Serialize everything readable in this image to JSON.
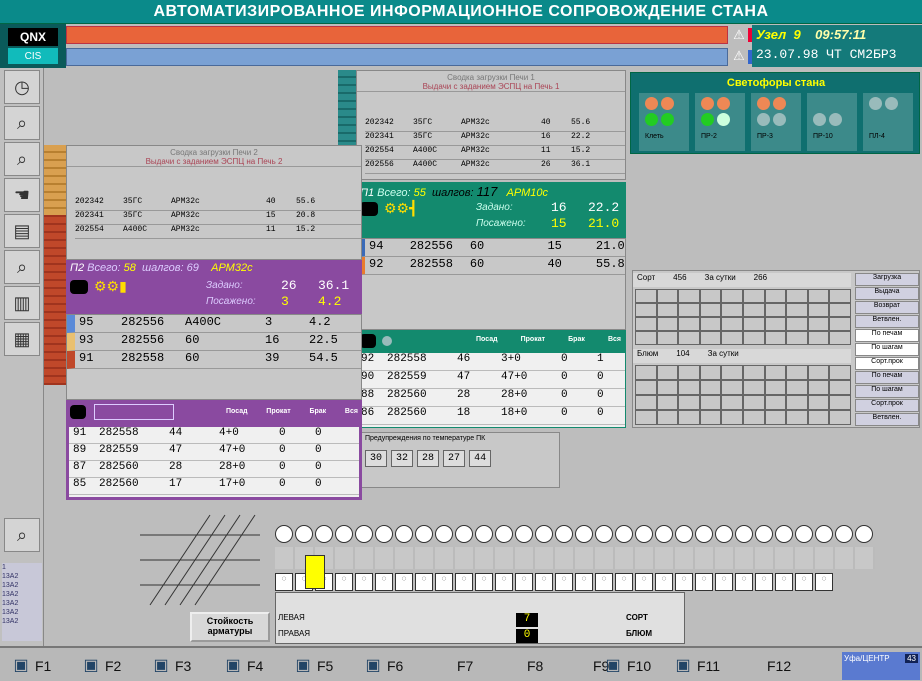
{
  "header": {
    "title": "АВТОМАТИЗИРОВАННОЕ ИНФОРМАЦИОННОЕ СОПРОВОЖДЕНИЕ СТАНА"
  },
  "logo": {
    "line1": "QNX",
    "line2": "CIS"
  },
  "status": {
    "node_label": "Узел",
    "node_value": "9",
    "time": "09:57:11",
    "date_line": "23.07.98 ЧТ СМ2БР3"
  },
  "semaphore": {
    "title": "Светофоры стана",
    "labels": [
      "Клеть",
      "ПР-2",
      "ПР-3",
      "ПР-10",
      "ПЛ-4"
    ]
  },
  "panel_top": {
    "title": "Сводка загрузки Печи 1",
    "subtitle": "Выдачи с заданием ЭСПЦ на Печь 1",
    "rows": [
      [
        "202342",
        "35ГС",
        "АРМ32с",
        "40",
        "55.6"
      ],
      [
        "202341",
        "35ГС",
        "АРМ32с",
        "16",
        "22.2"
      ],
      [
        "202554",
        "А400С",
        "АРМ32с",
        "11",
        "15.2"
      ],
      [
        "202556",
        "А400С",
        "АРМ32с",
        "26",
        "36.1"
      ]
    ]
  },
  "green1": {
    "label": "П1",
    "total_label": "Всего:",
    "total": "55",
    "ingots_label": "шалгов:",
    "ingots": "117",
    "product": "АРМ10с",
    "assigned_label": "Задано:",
    "assigned_a": "16",
    "assigned_b": "22.2",
    "posted_label": "Посажено:",
    "posted_a": "15",
    "posted_b": "21.0",
    "rows": [
      [
        "94",
        "282556",
        "60",
        "15",
        "21.0"
      ],
      [
        "92",
        "282558",
        "60",
        "40",
        "55.8"
      ]
    ]
  },
  "panel_left": {
    "title": "Сводка загрузки Печи 2",
    "subtitle": "Выдачи с заданием ЭСПЦ на Печь 2",
    "rows": [
      [
        "202342",
        "35ГС",
        "АРМ32с",
        "40",
        "55.6"
      ],
      [
        "202341",
        "35ГС",
        "АРМ32с",
        "15",
        "20.8"
      ],
      [
        "202554",
        "А400С",
        "АРМ32с",
        "11",
        "15.2"
      ]
    ]
  },
  "purple1": {
    "label": "П2",
    "total_label": "Всего:",
    "total": "58",
    "ingots_label": "шалгов:",
    "ingots": "69",
    "product": "АРМ32с",
    "assigned_label": "Задано:",
    "assigned_a": "26",
    "assigned_b": "36.1",
    "posted_label": "Посажено:",
    "posted_a": "3",
    "posted_b": "4.2",
    "rows": [
      [
        "95",
        "282556",
        "А400С",
        "3",
        "4.2"
      ],
      [
        "93",
        "282556",
        "60",
        "16",
        "22.5"
      ],
      [
        "91",
        "282558",
        "60",
        "39",
        "54.5"
      ]
    ]
  },
  "purple2": {
    "headers": [
      "Посад",
      "Прокат",
      "Брак",
      "Вся"
    ],
    "rows": [
      [
        "91",
        "282558",
        "44",
        "4+0",
        "0",
        "0"
      ],
      [
        "89",
        "282559",
        "47",
        "47+0",
        "0",
        "0"
      ],
      [
        "87",
        "282560",
        "28",
        "28+0",
        "0",
        "0"
      ],
      [
        "85",
        "282560",
        "17",
        "17+0",
        "0",
        "0"
      ]
    ]
  },
  "green2": {
    "headers": [
      "Посад",
      "Прокат",
      "Брак",
      "Вся"
    ],
    "rows": [
      [
        "92",
        "282558",
        "46",
        "3+0",
        "0",
        "1"
      ],
      [
        "90",
        "282559",
        "47",
        "47+0",
        "0",
        "0"
      ],
      [
        "88",
        "282560",
        "28",
        "28+0",
        "0",
        "0"
      ],
      [
        "86",
        "282560",
        "18",
        "18+0",
        "0",
        "0"
      ]
    ]
  },
  "temp": {
    "title": "Предупреждения по температуре ПК",
    "values": [
      "30",
      "32",
      "28",
      "27",
      "44"
    ]
  },
  "sort_panel": {
    "tab1": "Сорт",
    "n1": "456",
    "per_day": "За сутки",
    "v1": "266",
    "tab2": "Блюм",
    "n2": "104",
    "v2": "",
    "side": [
      "Загрузка",
      "Выдача",
      "Возврат",
      "Ветвлен.",
      "По печам",
      "По шагам",
      "Сорт.прок",
      "По печам",
      "По шагам",
      "Сорт.прок",
      "Ветвлен."
    ]
  },
  "bottom": {
    "button": "Стойкость арматуры",
    "r1": "ЛЕВАЯ",
    "r2": "ПРАВАЯ",
    "v_sort": "СОРТ",
    "v_blum": "БЛЮМ",
    "n1": "7",
    "n2": "0"
  },
  "fkeys": [
    "F1",
    "F2",
    "F3",
    "F4",
    "F5",
    "F6",
    "F7",
    "F8",
    "F9",
    "F10",
    "F11",
    "F12"
  ],
  "corner": {
    "line1": "Уфа/ЦЕНТР",
    "n": "43"
  },
  "colors": {
    "teal": "#138a6e",
    "purple": "#8a4aa0",
    "orange": "#e8643a",
    "blue": "#7aa1d4"
  }
}
